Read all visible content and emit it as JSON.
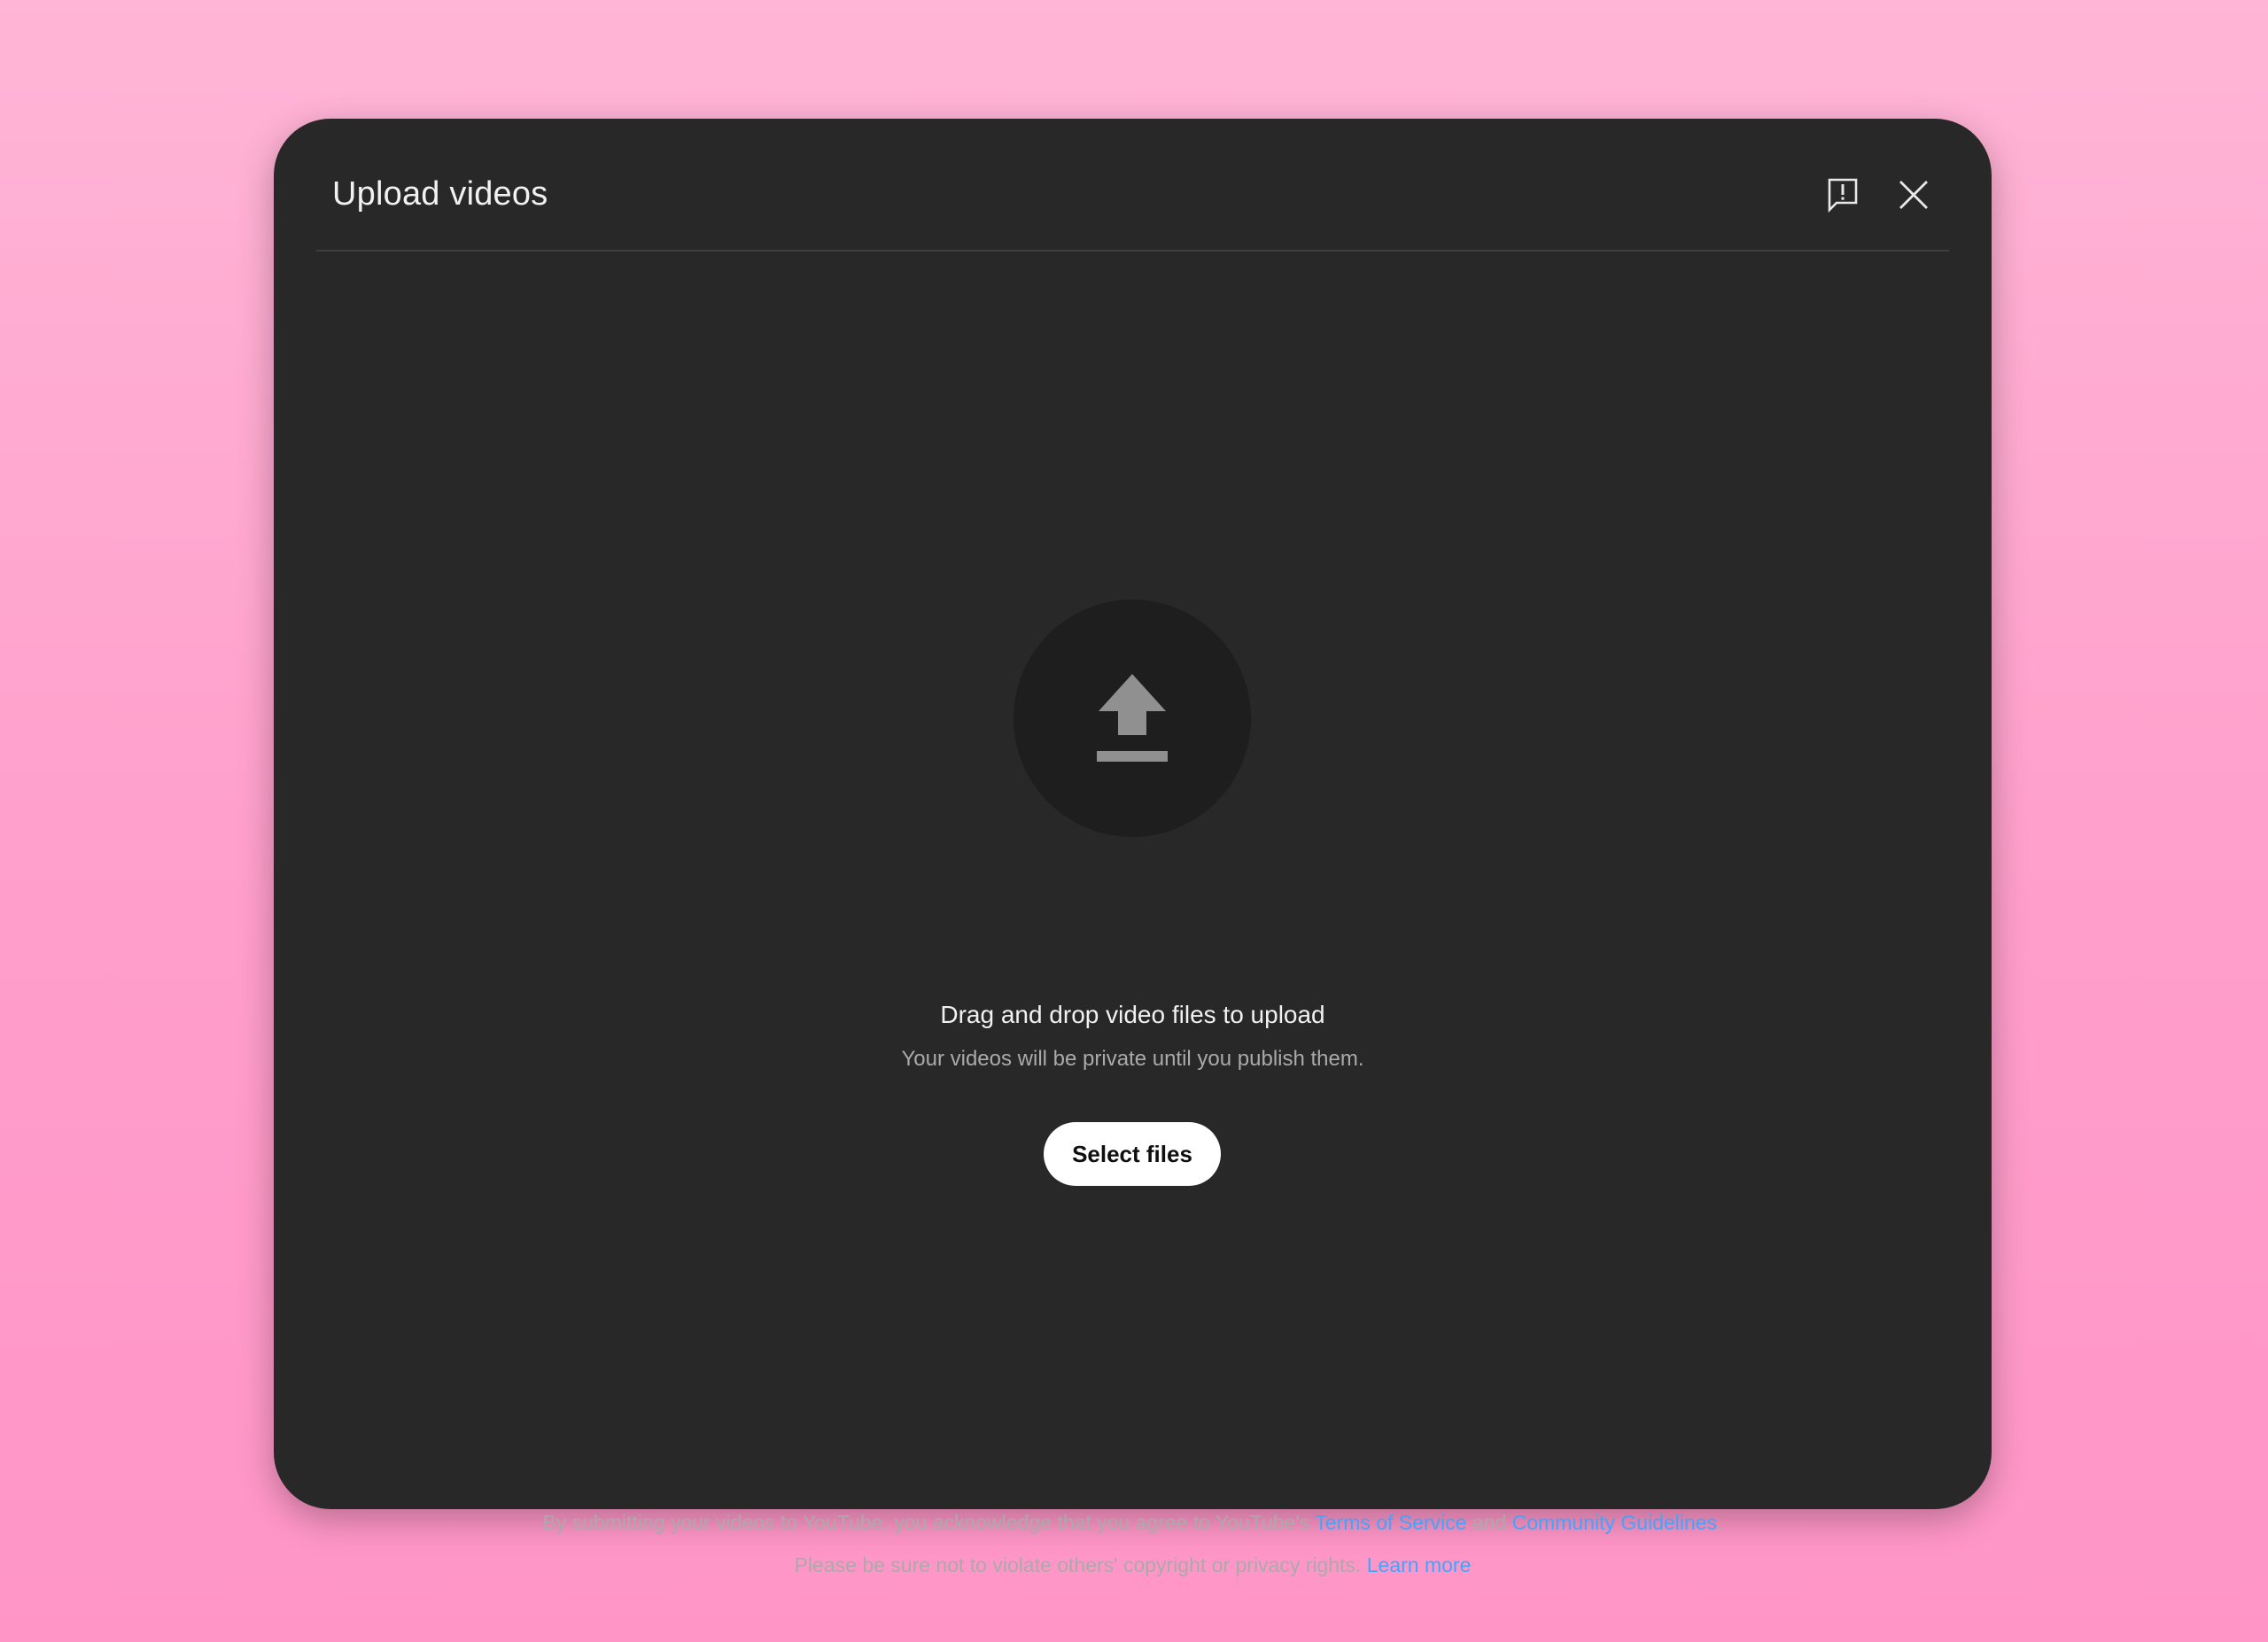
{
  "dialog": {
    "title": "Upload videos",
    "icons": {
      "feedback": "feedback-icon",
      "close": "close-icon",
      "upload": "upload-arrow-icon"
    }
  },
  "dropzone": {
    "heading": "Drag and drop video files to upload",
    "subtext": "Your videos will be private until you publish them.",
    "button_label": "Select files"
  },
  "footer": {
    "line1_prefix": "By submitting your videos to YouTube, you acknowledge that you agree to YouTube's ",
    "terms_link": "Terms of Service",
    "and_text": " and ",
    "guidelines_link": "Community Guidelines",
    "line1_suffix": ".",
    "line2_prefix": "Please be sure not to violate others' copyright or privacy rights. ",
    "learn_more_link": "Learn more"
  },
  "colors": {
    "background_top": "#ffb5d6",
    "background_bottom": "#ff95c7",
    "dialog_bg": "#282828",
    "link": "#3ea6ff",
    "button_bg": "#ffffff"
  }
}
